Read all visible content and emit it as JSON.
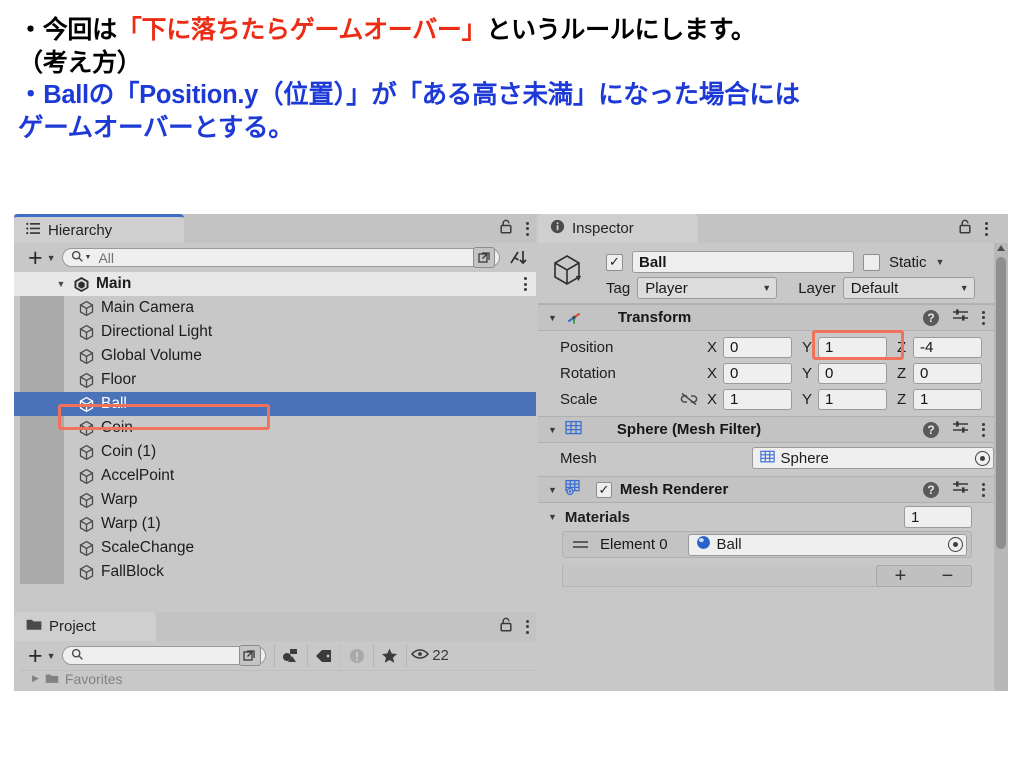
{
  "slide": {
    "line1_a": "・今回は",
    "line1_red": "「下に落ちたらゲームオーバー」",
    "line1_b": "というルールにします。",
    "line2": "（考え方）",
    "line3": "・Ballの「Position.y（位置）」が「ある高さ未満」になった場合には",
    "line4": "ゲームオーバーとする。",
    "color_red": "#ec2d16",
    "color_blue": "#1d3ad7"
  },
  "hierarchy": {
    "tab_label": "Hierarchy",
    "tab_icon": "list-icon",
    "lock_icon": "lock-icon",
    "menu_icon": "kebab-menu-icon",
    "add_label": "+",
    "search_placeholder": "All",
    "search_value": "",
    "sort_icon": "sort-icon",
    "expand_icon": "expand-window-icon",
    "scene": {
      "name": "Main",
      "expanded": true
    },
    "items": [
      {
        "name": "Main Camera",
        "selected": false
      },
      {
        "name": "Directional Light",
        "selected": false
      },
      {
        "name": "Global Volume",
        "selected": false
      },
      {
        "name": "Floor",
        "selected": false
      },
      {
        "name": "Ball",
        "selected": true
      },
      {
        "name": "Coin",
        "selected": false
      },
      {
        "name": "Coin (1)",
        "selected": false
      },
      {
        "name": "AccelPoint",
        "selected": false
      },
      {
        "name": "Warp",
        "selected": false
      },
      {
        "name": "Warp (1)",
        "selected": false
      },
      {
        "name": "ScaleChange",
        "selected": false
      },
      {
        "name": "FallBlock",
        "selected": false
      }
    ]
  },
  "project": {
    "tab_label": "Project",
    "tab_icon": "folder-icon",
    "lock_icon": "lock-icon",
    "menu_icon": "kebab-menu-icon",
    "add_label": "+",
    "search_placeholder": "",
    "search_value": "",
    "tools": [
      {
        "icon": "asset-type-filter-icon"
      },
      {
        "icon": "label-filter-icon"
      },
      {
        "icon": "warning-filter-icon"
      },
      {
        "icon": "star-favorite-icon"
      }
    ],
    "visible_count": "22",
    "visible_icon": "eye-icon",
    "cut_row_label": "Favorites"
  },
  "inspector": {
    "tab_label": "Inspector",
    "tab_icon": "info-icon",
    "lock_icon": "lock-icon",
    "menu_icon": "kebab-menu-icon",
    "object": {
      "enabled": true,
      "name": "Ball",
      "static_label": "Static",
      "static_checked": false,
      "tag_label": "Tag",
      "tag_value": "Player",
      "layer_label": "Layer",
      "layer_value": "Default"
    },
    "transform": {
      "title": "Transform",
      "icon": "transform-axis-icon",
      "expanded": true,
      "rows": [
        {
          "label": "Position",
          "x": "0",
          "y": "1",
          "z": "-4",
          "highlight": "y"
        },
        {
          "label": "Rotation",
          "x": "0",
          "y": "0",
          "z": "0",
          "highlight": ""
        },
        {
          "label": "Scale",
          "x": "1",
          "y": "1",
          "z": "1",
          "highlight": "",
          "link_icon": "broken-link-icon"
        }
      ]
    },
    "mesh_filter": {
      "title": "Sphere (Mesh Filter)",
      "icon": "mesh-filter-grid-icon",
      "expanded": true,
      "mesh_label": "Mesh",
      "mesh_value": "Sphere",
      "mesh_value_icon": "mesh-grid-icon"
    },
    "mesh_renderer": {
      "title": "Mesh Renderer",
      "icon": "mesh-renderer-icon",
      "enabled": true,
      "expanded": true,
      "materials_label": "Materials",
      "materials_count": "1",
      "element_label": "Element 0",
      "element_value": "Ball",
      "element_icon": "material-sphere-icon",
      "add_label": "+",
      "remove_label": "−"
    },
    "header_icons": {
      "help": "?",
      "preset": "preset-icon",
      "menu": "kebab-menu-icon"
    }
  },
  "colors": {
    "selection_blue": "#4a72b8",
    "annotation_red": "#f2715a",
    "panel_gray": "#c8c8c8",
    "tab_active_underline": "#3d6ec4"
  }
}
